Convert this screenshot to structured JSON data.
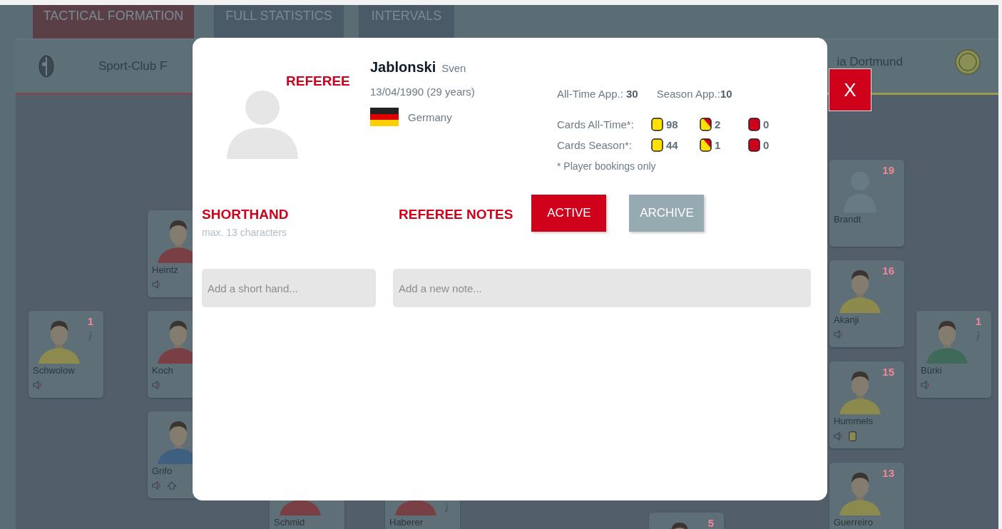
{
  "tabs": [
    {
      "label": "TACTICAL FORMATION",
      "selected": true
    },
    {
      "label": "FULL STATISTICS",
      "selected": false
    },
    {
      "label": "INTERVALS",
      "selected": false
    }
  ],
  "match_header": {
    "home_team": "Sport-Club F",
    "away_team": "ia Dortmund"
  },
  "players": [
    {
      "name": "Schwolow",
      "number": "1",
      "info": true,
      "speaker": true,
      "substitution": false,
      "booked": false
    },
    {
      "name": "Heintz",
      "info": false,
      "speaker": true,
      "substitution": false,
      "booked": false
    },
    {
      "name": "Koch",
      "info": false,
      "speaker": true,
      "substitution": false,
      "booked": false
    },
    {
      "name": "Grifo",
      "info": false,
      "speaker": true,
      "substitution": true,
      "booked": false
    },
    {
      "name": "Schmid",
      "info": false,
      "speaker": false,
      "substitution": false,
      "booked": false
    },
    {
      "name": "Haberer",
      "info": true,
      "speaker": false,
      "substitution": false,
      "booked": false
    },
    {
      "number": "5",
      "info": false,
      "speaker": false,
      "substitution": false,
      "booked": false
    },
    {
      "name": "Brandt",
      "number": "19",
      "kind": "placeholder",
      "info": false,
      "speaker": false,
      "substitution": false,
      "booked": false
    },
    {
      "name": "Akanji",
      "number": "16",
      "info": false,
      "speaker": true,
      "substitution": false,
      "booked": false
    },
    {
      "name": "Hummels",
      "number": "15",
      "info": false,
      "speaker": true,
      "substitution": false,
      "booked": true
    },
    {
      "name": "Guerreiro",
      "number": "13",
      "info": false,
      "speaker": false,
      "substitution": false,
      "booked": false
    },
    {
      "name": "Bürki",
      "number": "1",
      "info": true,
      "speaker": true,
      "substitution": false,
      "booked": false
    }
  ],
  "referee_modal": {
    "role_label": "REFEREE",
    "surname": "Jablonski",
    "first_name": "Sven",
    "birth": "13/04/1990 (29 years)",
    "nationality": "Germany",
    "appearances": [
      "All-Time App.: **30**",
      "Season App.:**10**"
    ],
    "card_rows": [
      {
        "label": "Cards All-Time*:",
        "cards": [
          {
            "kind": "yellow",
            "count": "98"
          },
          {
            "kind": "yellow_red",
            "count": "2"
          },
          {
            "kind": "red",
            "count": "0"
          }
        ]
      },
      {
        "label": "Cards Season*:",
        "cards": [
          {
            "kind": "yellow",
            "count": "44"
          },
          {
            "kind": "yellow_red",
            "count": "1"
          },
          {
            "kind": "red",
            "count": "0"
          }
        ]
      }
    ],
    "footnote": "* Player bookings only",
    "close_label": "X",
    "shorthand": {
      "title": "SHORTHAND",
      "hint": "max. 13 characters",
      "placeholder": "Add a short hand..."
    },
    "notes": {
      "title": "REFEREE NOTES",
      "tabs": [
        {
          "label": "ACTIVE",
          "selected": true
        },
        {
          "label": "ARCHIVE",
          "selected": false
        }
      ],
      "placeholder": "Add a new note..."
    }
  }
}
